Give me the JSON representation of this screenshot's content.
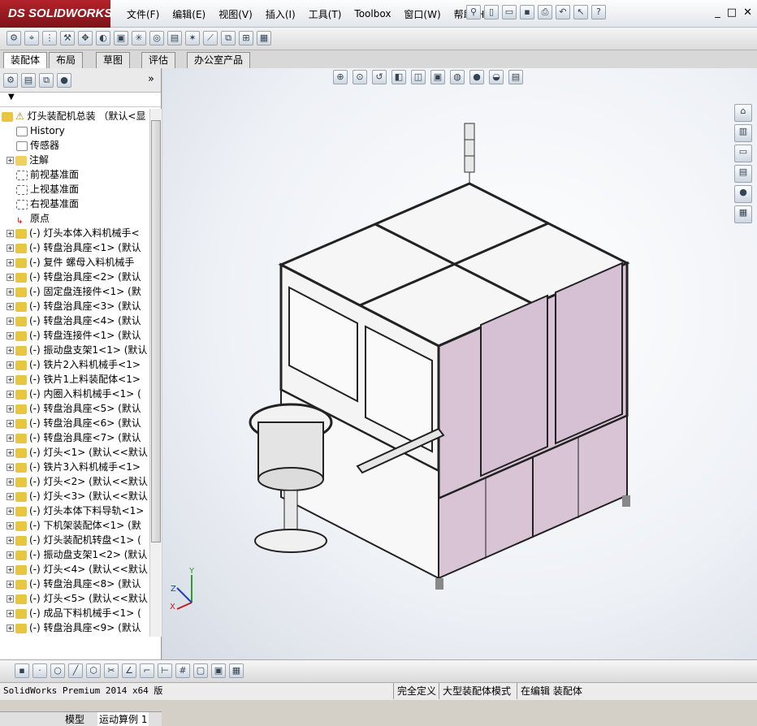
{
  "app": {
    "logo_text": "SOLIDWORKS",
    "logo_prefix": "DS"
  },
  "menu": [
    "文件(F)",
    "编辑(E)",
    "视图(V)",
    "插入(I)",
    "工具(T)",
    "Toolbox",
    "窗口(W)",
    "帮助(H)"
  ],
  "window_buttons": [
    "_",
    "□",
    "✕"
  ],
  "tabs": [
    "装配体",
    "布局",
    "草图",
    "评估",
    "办公室产品"
  ],
  "tree": {
    "root": "灯头装配机总装 （默认<显",
    "fixed_items": [
      "History",
      "传感器",
      "注解",
      "前视基准面",
      "上视基准面",
      "右视基准面",
      "原点"
    ],
    "components": [
      "(-) 灯头本体入料机械手<",
      "(-) 转盘治具座<1> (默认",
      "(-) 复件 螺母入料机械手",
      "(-) 转盘治具座<2> (默认",
      "(-) 固定盘连接件<1> (默",
      "(-) 转盘治具座<3> (默认",
      "(-) 转盘治具座<4> (默认",
      "(-) 转盘连接件<1> (默认",
      "(-) 振动盘支架1<1> (默认",
      "(-) 铁片2入料机械手<1>",
      "(-) 铁片1上料装配体<1>",
      "(-) 内圈入料机械手<1> (",
      "(-) 转盘治具座<5> (默认",
      "(-) 转盘治具座<6> (默认",
      "(-) 转盘治具座<7> (默认",
      "(-) 灯头<1> (默认<<默认",
      "(-) 铁片3入料机械手<1>",
      "(-) 灯头<2> (默认<<默认",
      "(-) 灯头<3> (默认<<默认",
      "(-) 灯头本体下料导轨<1>",
      "(-) 下机架装配体<1> (默",
      "(-) 灯头装配机转盘<1> (",
      "(-) 振动盘支架1<2> (默认",
      "(-) 灯头<4> (默认<<默认",
      "(-) 转盘治具座<8> (默认",
      "(-) 灯头<5> (默认<<默认",
      "(-) 成品下料机械手<1> (",
      "(-) 转盘治具座<9> (默认"
    ]
  },
  "bottom_tabs": [
    "模型",
    "运动算例 1"
  ],
  "status": {
    "left": "SolidWorks Premium 2014 x64 版",
    "seg1": "完全定义",
    "seg2": "大型装配体模式",
    "seg3": "在编辑 装配体"
  },
  "triad": {
    "x": "X",
    "y": "Y",
    "z": "Z"
  },
  "colors": {
    "panel_fill": "#d9c4d6",
    "frame": "#3a3a3a",
    "accent": "#b4232a"
  }
}
